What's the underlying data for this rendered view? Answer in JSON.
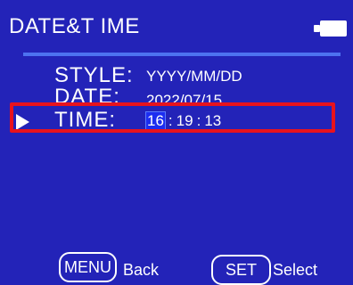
{
  "header": {
    "title": "DATE&T IME",
    "battery_icon": "battery-icon"
  },
  "settings": {
    "style": {
      "label": "STYLE:",
      "value": "YYYY/MM/DD"
    },
    "date": {
      "label": "DATE:",
      "value": "2022/07/15"
    },
    "time": {
      "label": "TIME:",
      "hours": "16",
      "minutes": "19",
      "seconds": "13",
      "separator": ":",
      "selected_field": "hours"
    }
  },
  "footer": {
    "menu_key": "MENU",
    "menu_action": "Back",
    "set_key": "SET",
    "set_action": "Select"
  },
  "colors": {
    "background": "#2323b8",
    "divider": "#4d72f0",
    "highlight": "#e8131d",
    "selected_field": "#1c2df0"
  }
}
